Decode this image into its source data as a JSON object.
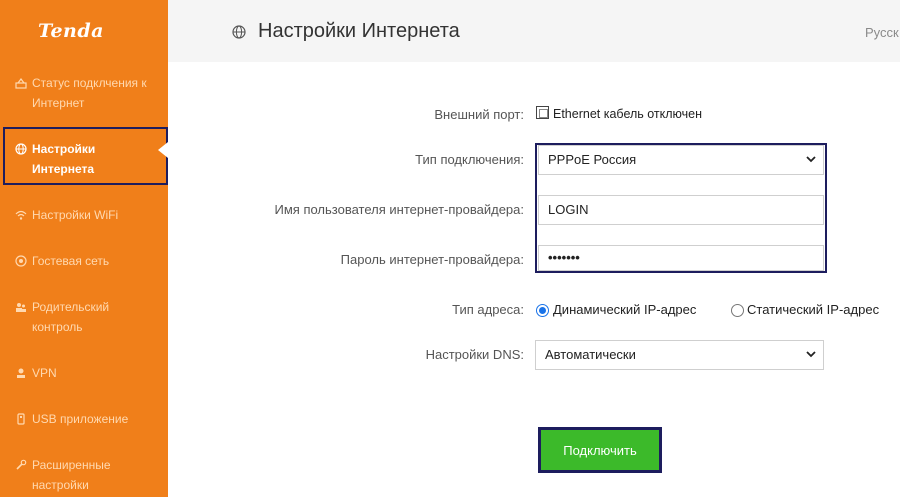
{
  "sidebar": {
    "logo": "Tenda",
    "items": [
      {
        "label": "Статус подклчения к Интернет",
        "icon": "status-icon"
      },
      {
        "label": "Настройки Интернета",
        "icon": "globe-icon",
        "active": true
      },
      {
        "label": "Настройки WiFi",
        "icon": "wifi-icon"
      },
      {
        "label": "Гостевая сеть",
        "icon": "guest-network-icon"
      },
      {
        "label": "Родительский контроль",
        "icon": "parental-control-icon"
      },
      {
        "label": "VPN",
        "icon": "vpn-icon"
      },
      {
        "label": "USB приложение",
        "icon": "usb-icon"
      },
      {
        "label": "Расширенные настройки",
        "icon": "wrench-icon"
      }
    ]
  },
  "header": {
    "title": "Настройки Интернета",
    "icon": "globe-icon",
    "language": "Русск"
  },
  "form": {
    "wan_port": {
      "label": "Внешний порт:",
      "status": "Ethernet кабель отключен"
    },
    "connection_type": {
      "label": "Тип подключения:",
      "value": "PPPoE Россия"
    },
    "username": {
      "label": "Имя пользователя интернет-провайдера:",
      "value": "LOGIN"
    },
    "password": {
      "label": "Пароль интернет-провайдера:",
      "value": "•••••••"
    },
    "address_type": {
      "label": "Тип адреса:",
      "options": [
        "Динамический IP-адрес",
        "Статический IP-адрес"
      ],
      "selected": "Динамический IP-адрес"
    },
    "dns": {
      "label": "Настройки DNS:",
      "value": "Автоматически"
    },
    "connect_button": "Подключить"
  },
  "colors": {
    "sidebar": "#f07f1a",
    "button": "#3cba2a",
    "highlight_border": "#1d1d5e",
    "radio_accent": "#1a73e8"
  }
}
